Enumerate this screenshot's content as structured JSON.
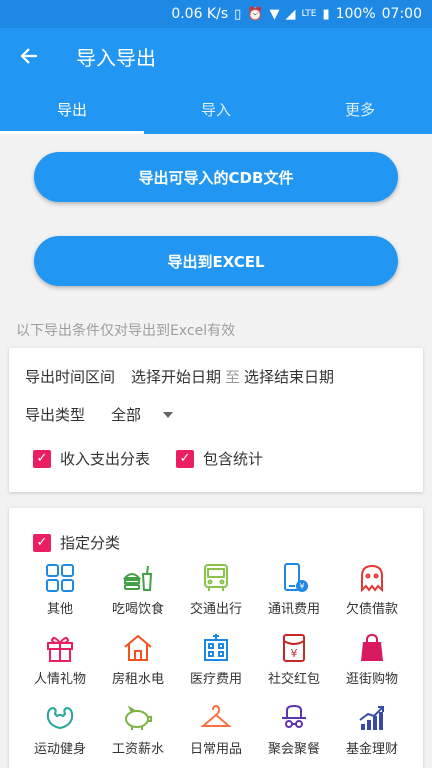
{
  "status": {
    "speed": "0.06 K/s",
    "network": "LTE",
    "battery": "100%",
    "time": "07:00"
  },
  "appbar": {
    "title": "导入导出"
  },
  "tabs": [
    {
      "label": "导出",
      "active": true
    },
    {
      "label": "导入",
      "active": false
    },
    {
      "label": "更多",
      "active": false
    }
  ],
  "buttons": {
    "export_cdb": "导出可导入的CDB文件",
    "export_excel": "导出到EXCEL"
  },
  "hint": "以下导出条件仅对导出到Excel有效",
  "conditions": {
    "time_label": "导出时间区间",
    "start_date": "选择开始日期",
    "to": "至",
    "end_date": "选择结束日期",
    "type_label": "导出类型",
    "type_value": "全部",
    "income_expense_category": {
      "label": "收入支出分表",
      "checked": true
    },
    "include_stats": {
      "label": "包含统计",
      "checked": true
    }
  },
  "category_section": {
    "label": "指定分类",
    "checked": true,
    "items": [
      {
        "label": "其他",
        "icon": "grid-icon",
        "color": "#1e88e5"
      },
      {
        "label": "吃喝饮食",
        "icon": "burger-drink-icon",
        "color": "#43a047"
      },
      {
        "label": "交通出行",
        "icon": "bus-icon",
        "color": "#8bc34a"
      },
      {
        "label": "通讯费用",
        "icon": "phone-icon",
        "color": "#1e88e5"
      },
      {
        "label": "欠债借款",
        "icon": "ghost-icon",
        "color": "#e53935"
      },
      {
        "label": "人情礼物",
        "icon": "gift-icon",
        "color": "#e91e63"
      },
      {
        "label": "房租水电",
        "icon": "house-icon",
        "color": "#f4511e"
      },
      {
        "label": "医疗费用",
        "icon": "hospital-icon",
        "color": "#1e88e5"
      },
      {
        "label": "社交红包",
        "icon": "red-envelope-icon",
        "color": "#c62828"
      },
      {
        "label": "逛街购物",
        "icon": "shopping-bag-icon",
        "color": "#d81b60"
      },
      {
        "label": "运动健身",
        "icon": "muscle-icon",
        "color": "#26a69a"
      },
      {
        "label": "工资薪水",
        "icon": "piggy-bank-icon",
        "color": "#7cb342"
      },
      {
        "label": "日常用品",
        "icon": "hanger-icon",
        "color": "#ff7043"
      },
      {
        "label": "聚会聚餐",
        "icon": "party-hat-icon",
        "color": "#5e35b1"
      },
      {
        "label": "基金理财",
        "icon": "chart-up-icon",
        "color": "#3949ab"
      }
    ]
  }
}
